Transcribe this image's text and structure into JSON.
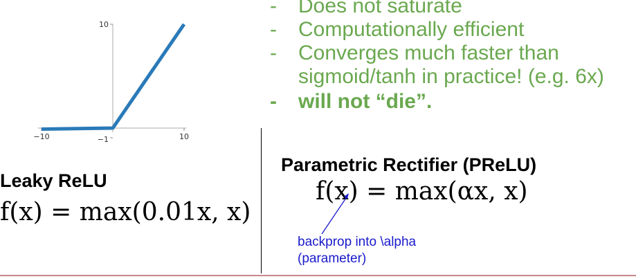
{
  "chart_data": {
    "type": "line",
    "series": [
      {
        "x": [
          -10,
          0,
          10
        ],
        "y": [
          -0.1,
          0,
          10
        ]
      }
    ],
    "xticks": [
      -10,
      10
    ],
    "yticks": [
      10
    ],
    "extra_tick_label": "-1",
    "color": "#2a7ab8"
  },
  "bullets": [
    {
      "text": "Does not saturate",
      "bold": false
    },
    {
      "text": "Computationally efficient",
      "bold": false
    },
    {
      "text": "Converges much faster than",
      "bold": false
    },
    {
      "text": "sigmoid/tanh in practice! (e.g. 6x)",
      "bold": false,
      "continuation": true
    },
    {
      "text": "will not “die”.",
      "bold": true
    }
  ],
  "bullet_dash": "-",
  "leaky": {
    "title": "Leaky ReLU",
    "formula": "f(x) = max(0.01x, x)"
  },
  "prelu": {
    "title": "Parametric Rectifier (PReLU)",
    "formula": "f(x) = max(αx, x)",
    "note_line1": "backprop into \\alpha",
    "note_line2": "(parameter)"
  },
  "colors": {
    "bullet_text": "#6aa84f",
    "note_text": "#1a1acc",
    "rule": "#c7878a"
  }
}
